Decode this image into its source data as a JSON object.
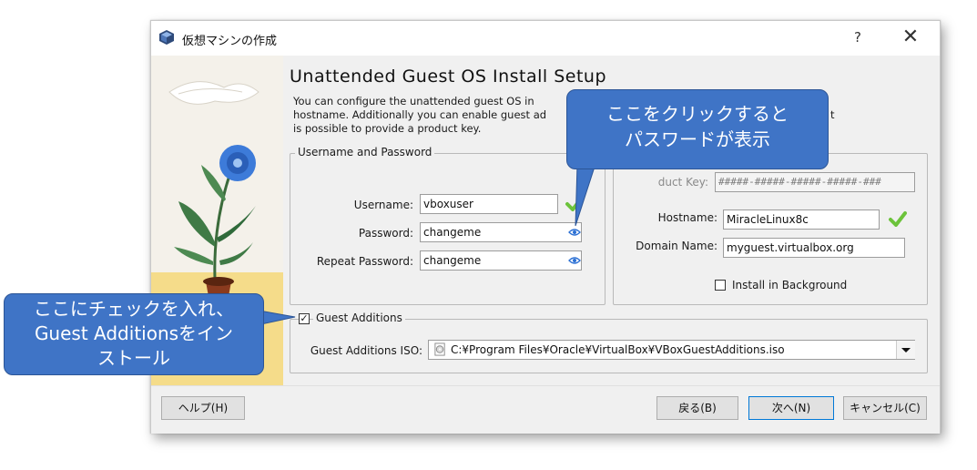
{
  "window": {
    "title": "仮想マシンの作成",
    "help_label": "?",
    "close_label": "✕"
  },
  "page": {
    "heading": "Unattended Guest OS Install Setup",
    "description_lines": [
      "You can configure the unattended guest OS in",
      "hostname. Additionally you can enable guest ad",
      "is possible to provide a product key."
    ],
    "description_right_fragment": "t"
  },
  "username_group": {
    "title": "Username and Password",
    "username_label": "Username:",
    "username_value": "vboxuser",
    "password_label": "Password:",
    "password_value": "changeme",
    "repeat_label": "Repeat Password:",
    "repeat_value": "changeme"
  },
  "options_group": {
    "product_key_label": "duct Key:",
    "product_key_value": "#####-#####-#####-#####-###",
    "hostname_label": "Hostname:",
    "hostname_value": "MiracleLinux8c",
    "domain_label": "Domain Name:",
    "domain_value": "myguest.virtualbox.org",
    "install_bg_label": "Install in Background",
    "install_bg_checked": false
  },
  "guest_additions": {
    "title": "Guest Additions",
    "checked": true,
    "checkbox_mark": "✓",
    "iso_label": "Guest Additions ISO:",
    "iso_value": "C:¥Program Files¥Oracle¥VirtualBox¥VBoxGuestAdditions.iso"
  },
  "footer": {
    "help_button": "ヘルプ(H)",
    "back_button": "戻る(B)",
    "next_button": "次へ(N)",
    "cancel_button": "キャンセル(C)"
  },
  "callouts": {
    "password_callout_lines": [
      "ここをクリックすると",
      "パスワードが表示"
    ],
    "checkbox_callout_lines": [
      "ここにチェックを入れ、",
      "Guest Additionsをイン",
      "ストール"
    ]
  },
  "colors": {
    "callout_fill": "#3f74c6",
    "check_green": "#6cc33b",
    "eye_blue": "#2a6fd4"
  }
}
